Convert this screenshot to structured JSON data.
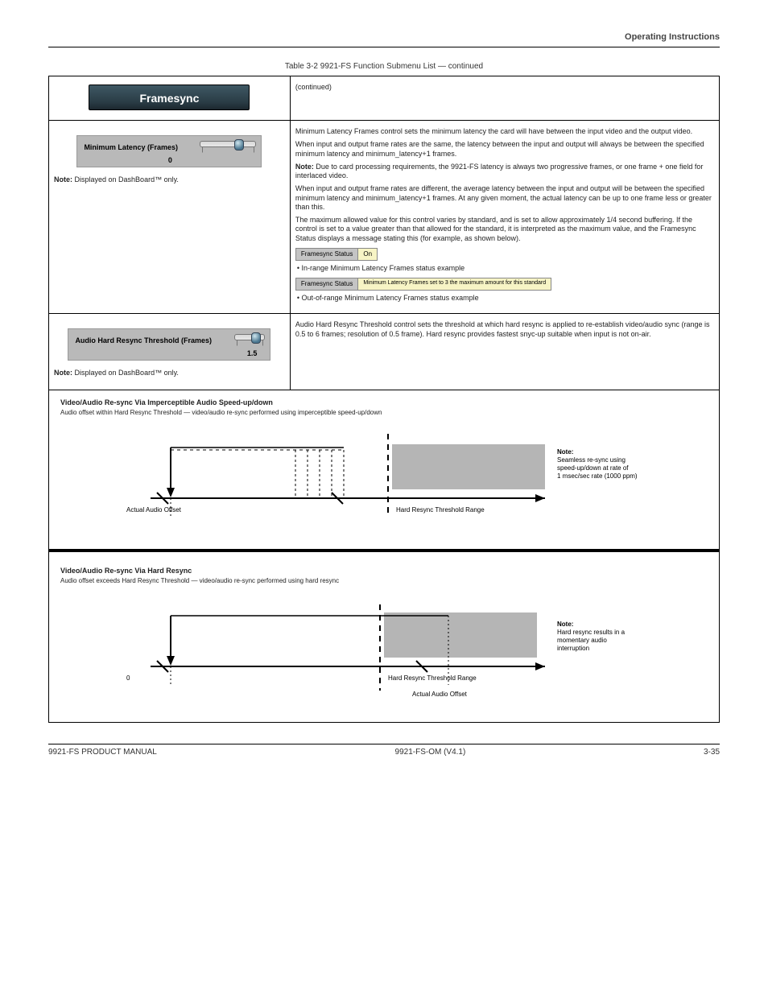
{
  "header": {
    "right": "Operating Instructions"
  },
  "caption": "Table 3-2  9921-FS Function Submenu List — continued",
  "framesync_tab": "Framesync",
  "row1": {
    "right_continued": "(continued)"
  },
  "min_latency": {
    "label": "Minimum Latency (Frames)",
    "value": "0",
    "left_note_title": "Note:",
    "left_note_body": "Displayed on DashBoard™ only.",
    "right_p1": "Minimum Latency Frames control sets the minimum latency the card will have between the input video and the output video.",
    "right_p2": "When input and output frame rates are the same, the latency between the input and output will always be between the specified minimum latency and minimum_latency+1 frames.",
    "right_note1_lbl": "Note:",
    "right_note1_body": "Due to card processing requirements, the 9921-FS latency is always two progressive frames, or one frame + one field for interlaced video.",
    "right_p3": "When input and output frame rates are different, the average latency between the input and output will be between the specified minimum latency and minimum_latency+1 frames. At any given moment, the actual latency can be up to one frame less or greater than this.",
    "right_p4": "The maximum allowed value for this control varies by standard, and is set to allow approximately 1/4 second buffering. If the control is set to a value greater than that allowed for the standard, it is interpreted as the maximum value, and the Framesync Status displays a message stating this (for example, as shown below).",
    "status1_lbl": "Framesync Status",
    "status1_val": "On",
    "status_inrange": "• In-range Minimum Latency Frames status example",
    "status2_lbl": "Framesync Status",
    "status2_val": "Minimum Latency Frames set to 3 the maximum amount for this standard",
    "status_oor": "• Out-of-range Minimum Latency Frames status example"
  },
  "resync": {
    "label": "Audio Hard Resync Threshold (Frames)",
    "value": "1.5",
    "left_note_title": "Note:",
    "left_note_body": "Displayed on DashBoard™ only.",
    "right_p1": "Audio Hard Resync Threshold control sets the threshold at which hard resync is applied to re-establish video/audio sync (range is 0.5 to 6 frames; resolution of 0.5 frame). Hard resync provides fastest snyc-up suitable when input is not on-air."
  },
  "diag1": {
    "title": "Video/Audio Re-sync Via Imperceptible Audio Speed-up/down",
    "sub": "Audio offset within Hard Resync Threshold — video/audio re-sync performed using imperceptible speed-up/down",
    "label_actual": "Actual Audio Offset",
    "label_range": "Hard Resync Threshold Range",
    "note_lbl": "Note:",
    "note_body": "Seamless re-sync using speed-up/down at rate of 1 msec/sec rate (1000 ppm)"
  },
  "diag2": {
    "title": "Video/Audio Re-sync Via Hard Resync",
    "sub": "Audio offset exceeds Hard Resync Threshold — video/audio re-sync performed using hard resync",
    "label_actual": "Actual Audio Offset",
    "label_range": "Hard Resync Threshold Range",
    "note_lbl": "Note:",
    "note_body": "Hard resync results in a momentary audio interruption"
  },
  "footer": {
    "left": "9921-FS PRODUCT MANUAL",
    "center": "9921-FS-OM (V4.1)",
    "right": "3-35"
  }
}
